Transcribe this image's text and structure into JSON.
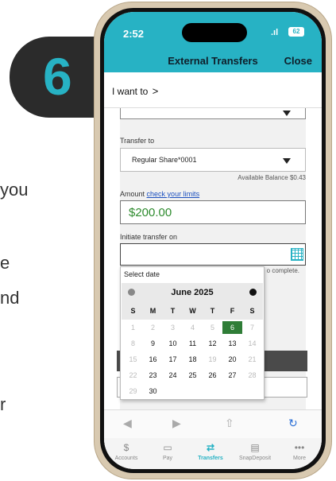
{
  "step": {
    "number": "6"
  },
  "background_text": [
    "you",
    "e",
    "nd",
    "r"
  ],
  "status_bar": {
    "time": "2:52",
    "signal": ".ıl",
    "battery": "62"
  },
  "nav": {
    "title": "External Transfers",
    "close": "Close"
  },
  "i_want": {
    "label": "I want to",
    "chevron": ">"
  },
  "form": {
    "transfer_to_label": "Transfer to",
    "transfer_to_value": "Regular Share*0001",
    "available_balance": "Available Balance $0.43",
    "amount_label": "Amount",
    "amount_link": "check your limits",
    "amount_value": "$200.00",
    "initiate_label": "Initiate transfer on",
    "complete_note": "o complete."
  },
  "date_picker": {
    "title": "Select date",
    "month": "June 2025",
    "weekdays": [
      "S",
      "M",
      "T",
      "W",
      "T",
      "F",
      "S"
    ],
    "weeks": [
      [
        "1",
        "2",
        "3",
        "4",
        "5",
        "6",
        "7"
      ],
      [
        "8",
        "9",
        "10",
        "11",
        "12",
        "13",
        "14"
      ],
      [
        "15",
        "16",
        "17",
        "18",
        "19",
        "20",
        "21"
      ],
      [
        "22",
        "23",
        "24",
        "25",
        "26",
        "27",
        "28"
      ],
      [
        "29",
        "30"
      ]
    ],
    "muted_days": [
      "1",
      "2",
      "3",
      "4",
      "5",
      "7",
      "8",
      "14",
      "15",
      "19",
      "21",
      "22",
      "28",
      "29"
    ],
    "selected_day": "6",
    "selected_color": "#2f7d37"
  },
  "browser_toolbar": {
    "back": "◀",
    "forward": "▶",
    "share": "⇧",
    "reload": "↻"
  },
  "tabs": [
    {
      "label": "Accounts",
      "icon": "dollar-coin-icon"
    },
    {
      "label": "Pay",
      "icon": "card-icon"
    },
    {
      "label": "Transfers",
      "icon": "transfer-arrows-icon",
      "active": true
    },
    {
      "label": "SnapDeposit",
      "icon": "check-deposit-icon"
    },
    {
      "label": "More",
      "icon": "ellipsis-icon"
    }
  ],
  "colors": {
    "accent": "#27b2c4",
    "badge_bg": "#2b2b2b",
    "amount_green": "#2e8b2e"
  }
}
